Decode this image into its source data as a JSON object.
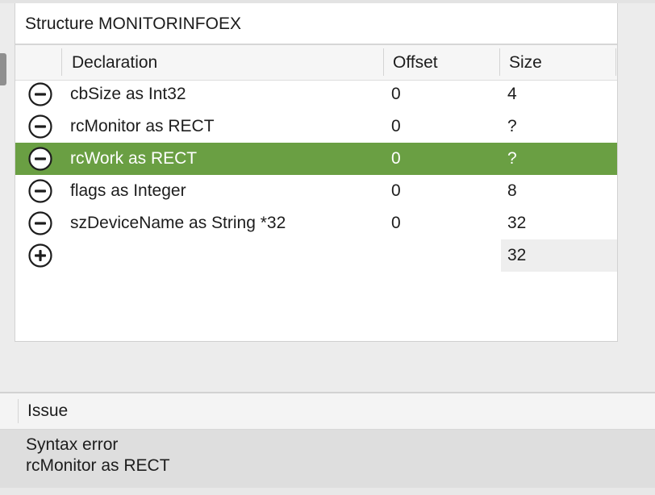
{
  "structure": {
    "title": "Structure MONITORINFOEX",
    "columns": {
      "declaration": "Declaration",
      "offset": "Offset",
      "size": "Size"
    },
    "rows": [
      {
        "declaration": "cbSize as Int32",
        "offset": "0",
        "size": "4",
        "selected": false
      },
      {
        "declaration": "rcMonitor as RECT",
        "offset": "0",
        "size": "?",
        "selected": false
      },
      {
        "declaration": "rcWork as RECT",
        "offset": "0",
        "size": "?",
        "selected": true
      },
      {
        "declaration": "flags as Integer",
        "offset": "0",
        "size": "8",
        "selected": false
      },
      {
        "declaration": "szDeviceName as String *32",
        "offset": "0",
        "size": "32",
        "selected": false
      }
    ],
    "total_size": "32",
    "icons": {
      "remove": "minus-circle-icon",
      "add": "plus-circle-icon"
    }
  },
  "issues": {
    "header": "Issue",
    "items": [
      {
        "title": "Syntax error",
        "detail": "rcMonitor as RECT"
      }
    ]
  },
  "colors": {
    "selected_row": "#6a9f43",
    "panel_background": "#ffffff",
    "window_background": "#ececec"
  }
}
